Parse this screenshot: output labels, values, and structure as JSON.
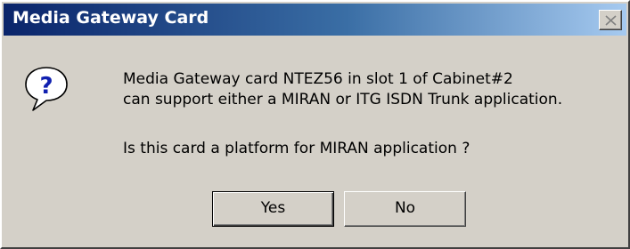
{
  "window": {
    "title": "Media Gateway Card",
    "close_icon": "close-icon"
  },
  "icon": {
    "name": "question-icon",
    "glyph": "?"
  },
  "message": {
    "line1": "Media Gateway card NTEZ56 in slot 1 of Cabinet#2",
    "line2": "can support either a MIRAN or ITG ISDN Trunk application.",
    "prompt": "Is this card a platform for MIRAN application ?"
  },
  "buttons": {
    "yes_label": "Yes",
    "no_label": "No",
    "default": "Yes"
  },
  "colors": {
    "titlebar_start": "#0a246a",
    "titlebar_end": "#a6caf0",
    "face": "#d4d0c8",
    "icon_blue": "#1020b0"
  }
}
